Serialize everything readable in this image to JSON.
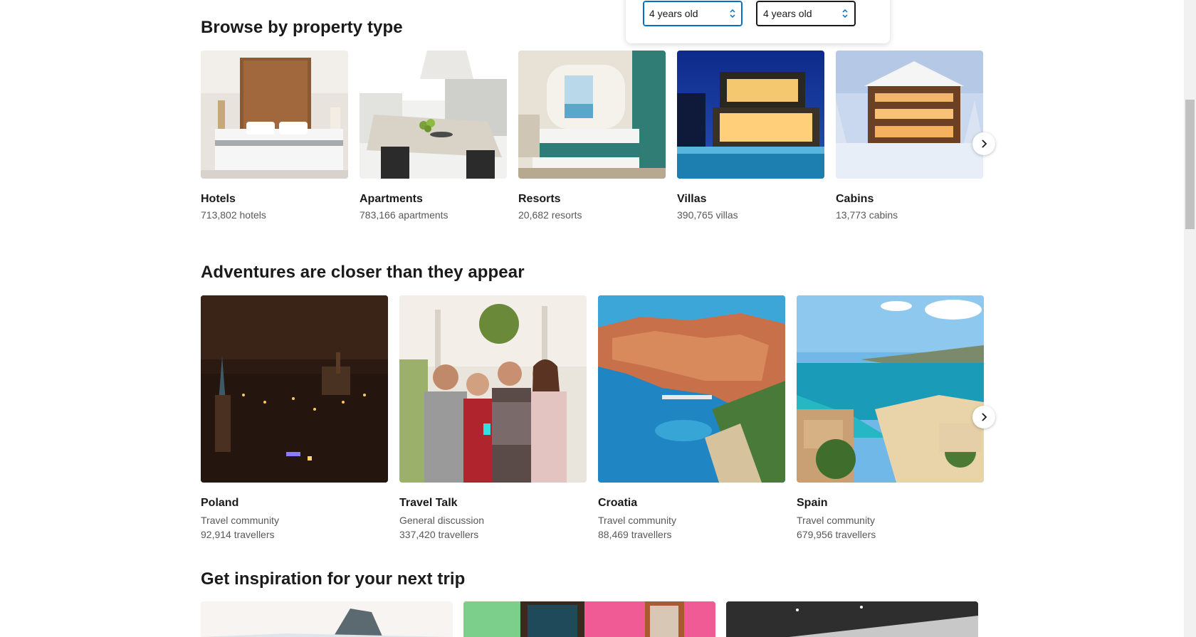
{
  "age_selectors": [
    {
      "value": "4 years old"
    },
    {
      "value": "4 years old"
    }
  ],
  "property_section": {
    "title": "Browse by property type",
    "items": [
      {
        "name": "Hotels",
        "count": "713,802 hotels"
      },
      {
        "name": "Apartments",
        "count": "783,166 apartments"
      },
      {
        "name": "Resorts",
        "count": "20,682 resorts"
      },
      {
        "name": "Villas",
        "count": "390,765 villas"
      },
      {
        "name": "Cabins",
        "count": "13,773 cabins"
      }
    ]
  },
  "adventures_section": {
    "title": "Adventures are closer than they appear",
    "items": [
      {
        "name": "Poland",
        "type": "Travel community",
        "travellers": "92,914 travellers"
      },
      {
        "name": "Travel Talk",
        "type": "General discussion",
        "travellers": "337,420 travellers"
      },
      {
        "name": "Croatia",
        "type": "Travel community",
        "travellers": "88,469 travellers"
      },
      {
        "name": "Spain",
        "type": "Travel community",
        "travellers": "679,956 travellers"
      }
    ]
  },
  "inspiration_section": {
    "title": "Get inspiration for your next trip"
  },
  "icons": {
    "next": "chevron-right-icon",
    "select": "up-down-chevron-icon"
  },
  "colors": {
    "accent": "#0071c2",
    "text": "#1a1a1a",
    "muted": "#595959"
  }
}
